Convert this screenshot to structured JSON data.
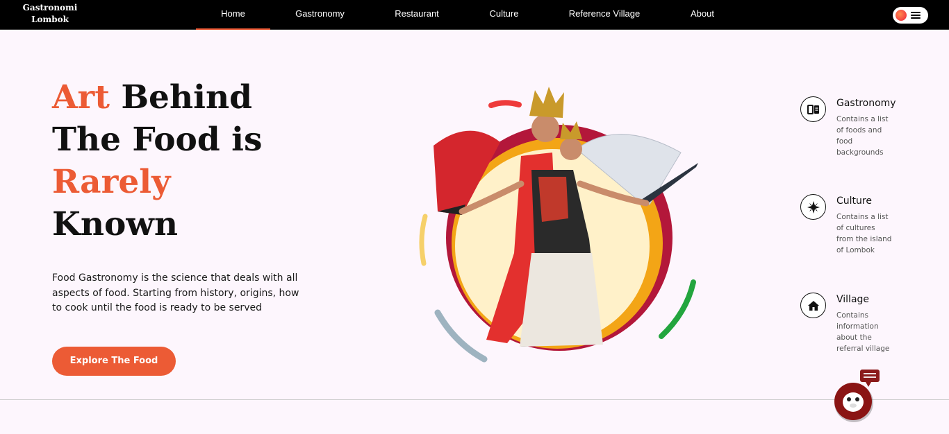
{
  "brand": {
    "line1": "Gastronomi",
    "line2": "Lombok"
  },
  "nav": {
    "items": [
      {
        "label": "Home",
        "active": true
      },
      {
        "label": "Gastronomy",
        "active": false
      },
      {
        "label": "Restaurant",
        "active": false
      },
      {
        "label": "Culture",
        "active": false
      },
      {
        "label": "Reference Village",
        "active": false
      },
      {
        "label": "About",
        "active": false
      }
    ]
  },
  "hero": {
    "w1": "Art",
    "w2": "Behind",
    "line2": "The Food is",
    "w3": "Rarely",
    "line4": "Known",
    "description": "Food Gastronomy is the science that deals with all aspects of food. Starting from history, origins, how to cook until the food is ready to be served",
    "cta": "Explore The Food"
  },
  "features": [
    {
      "title": "Gastronomy",
      "text": "Contains a list of foods and food backgrounds",
      "icon": "menu-book-icon"
    },
    {
      "title": "Culture",
      "text": "Contains a list of cultures from the island of Lombok",
      "icon": "compass-icon"
    },
    {
      "title": "Village",
      "text": "Contains information about the referral village",
      "icon": "house-icon"
    }
  ],
  "colors": {
    "accent": "#ec5b35",
    "maroon": "#b3173a",
    "orange": "#f3a516",
    "cream": "#fff1c9"
  }
}
